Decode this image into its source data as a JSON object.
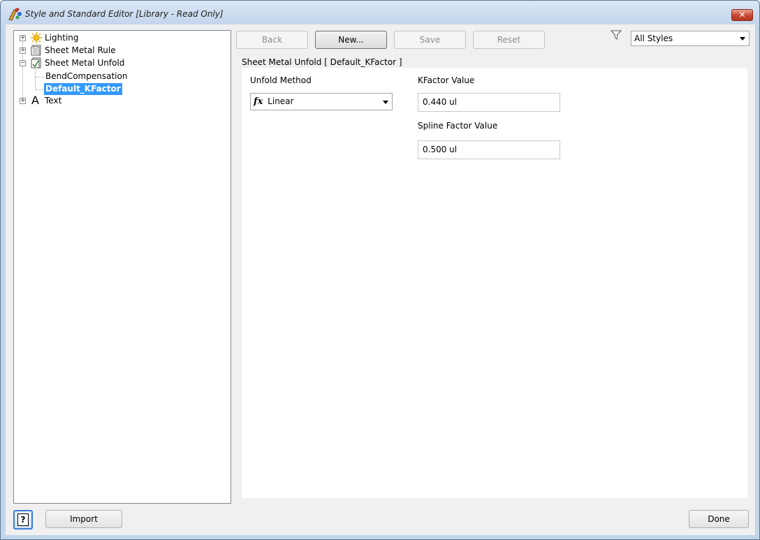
{
  "window": {
    "title": "Style and Standard Editor [Library - Read Only]",
    "close_glyph": "✕",
    "accent_color": "#3399ff"
  },
  "tree": {
    "items": [
      {
        "label": "Lighting",
        "icon": "lighting-icon",
        "expander": "+"
      },
      {
        "label": "Sheet Metal Rule",
        "icon": "sheet-metal-rule-icon",
        "expander": "+"
      },
      {
        "label": "Sheet Metal Unfold",
        "icon": "sheet-metal-unfold-icon",
        "expander": "−"
      },
      {
        "label": "BendCompensation"
      },
      {
        "label": "Default_KFactor",
        "selected": true
      },
      {
        "label": "Text",
        "icon": "text-style-icon",
        "expander": "+",
        "glyph": "A"
      }
    ]
  },
  "toolbar": {
    "back_label": "Back",
    "new_label": "New...",
    "save_label": "Save",
    "reset_label": "Reset",
    "filter_icon": "filter-icon",
    "filter_value": "All Styles"
  },
  "editor": {
    "group_title": "Sheet Metal Unfold [ Default_KFactor ]",
    "unfold_method_label": "Unfold Method",
    "unfold_method_prefix": "fx",
    "unfold_method_value": "Linear",
    "kfactor_label": "KFactor Value",
    "kfactor_value": "0.440 ul",
    "spline_label": "Spline Factor Value",
    "spline_value": "0.500 ul"
  },
  "footer": {
    "help_glyph": "?",
    "import_label": "Import",
    "done_label": "Done"
  }
}
